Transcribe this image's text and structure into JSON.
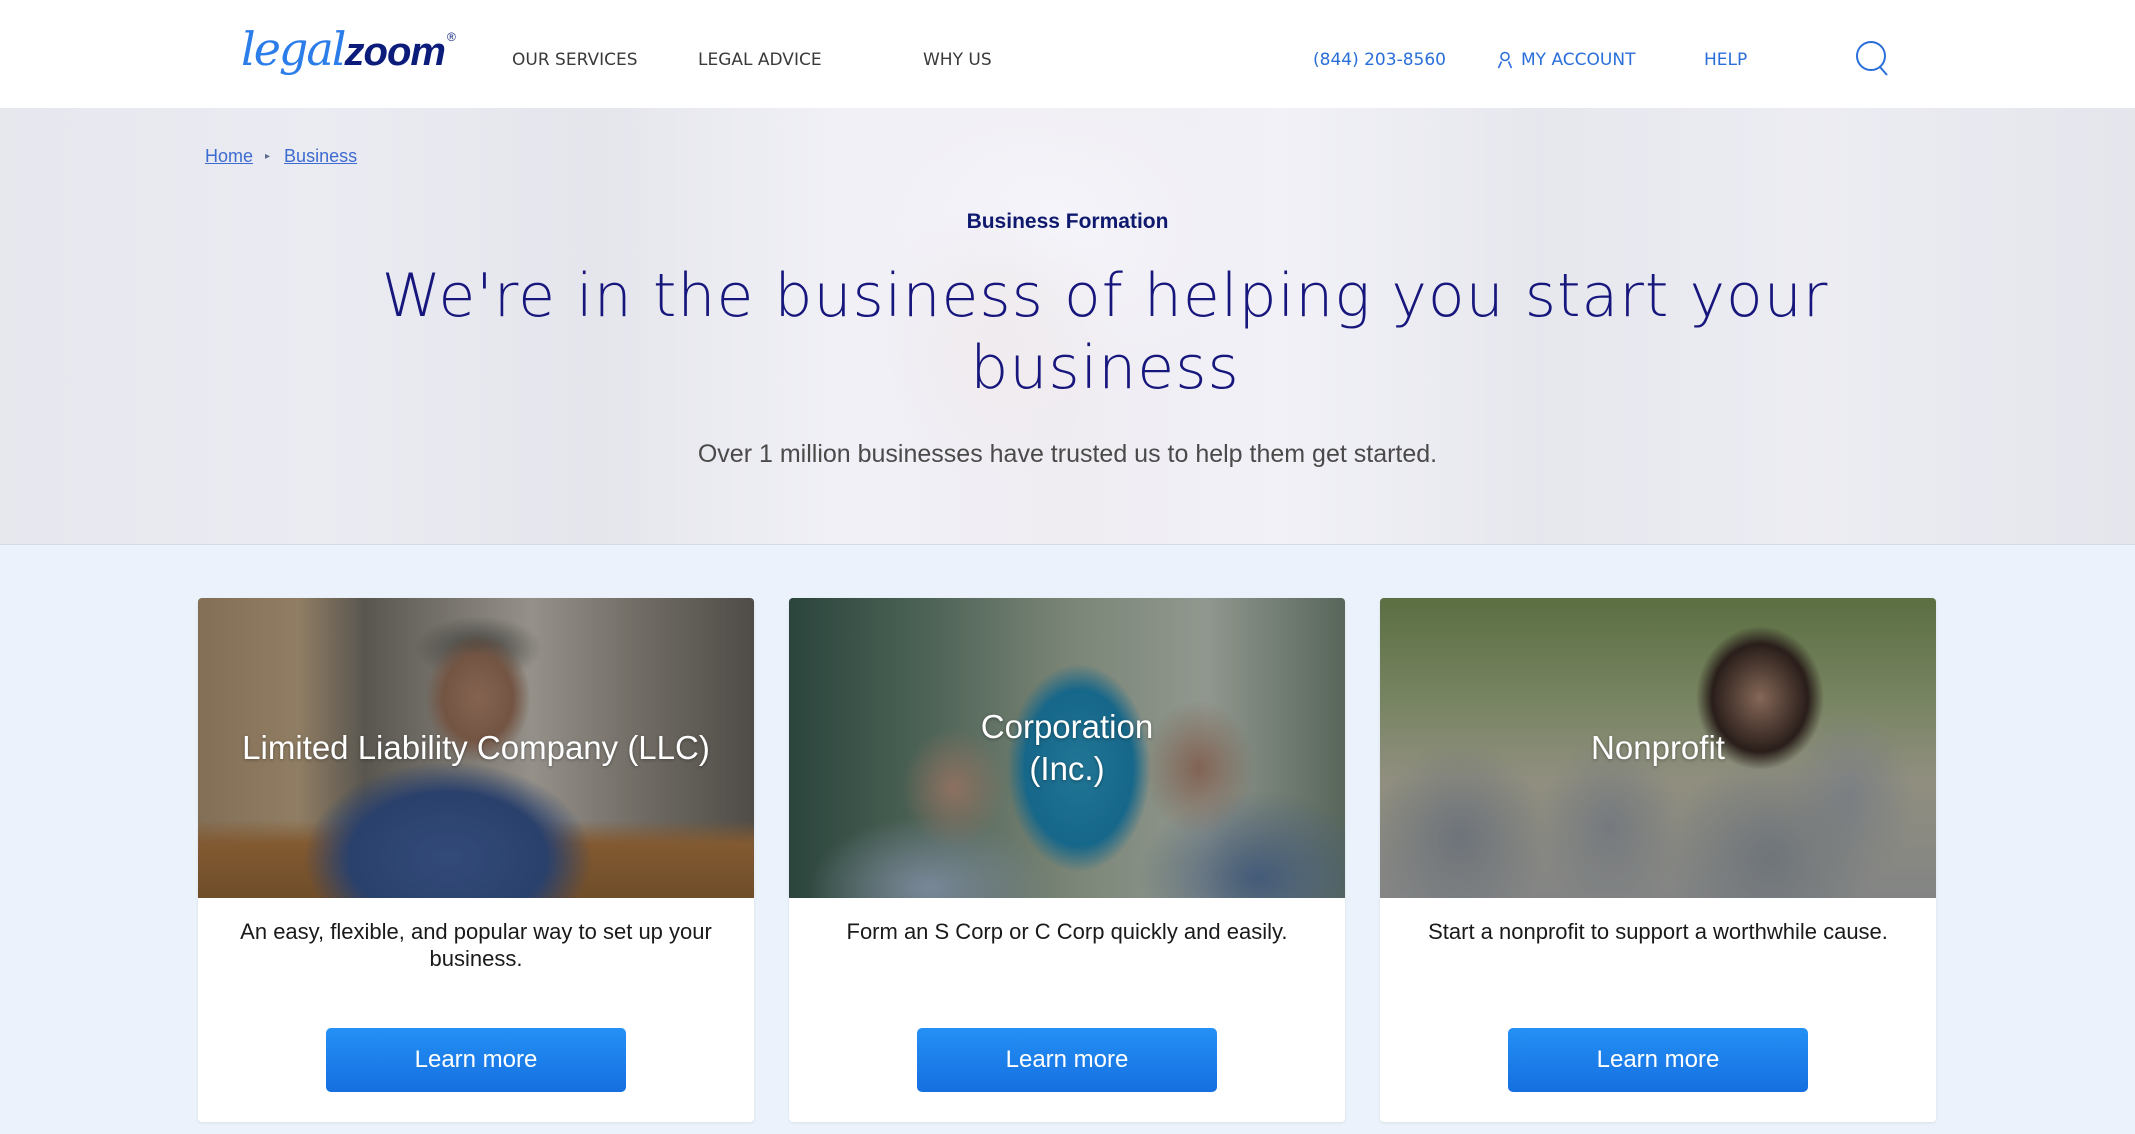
{
  "header": {
    "logo": {
      "part1": "legal",
      "part2": "zoom",
      "registered": "®"
    },
    "nav": [
      {
        "label": "OUR SERVICES"
      },
      {
        "label": "LEGAL ADVICE"
      },
      {
        "label": "WHY US"
      }
    ],
    "phone": "(844) 203-8560",
    "account_label": "MY ACCOUNT",
    "help_label": "HELP",
    "icons": {
      "account": "user-icon",
      "search": "search-icon"
    },
    "accent_color": "#2a6fd9"
  },
  "hero": {
    "breadcrumb": [
      {
        "label": "Home"
      },
      {
        "label": "Business"
      }
    ],
    "breadcrumb_separator": "▸",
    "eyebrow": "Business Formation",
    "title": "We're in the business of helping you start your business",
    "subtitle": "Over 1 million businesses have trusted us to help them get started."
  },
  "cards": [
    {
      "title": "Limited Liability Company (LLC)",
      "description": "An easy, flexible, and popular way to set up your business.",
      "button_label": "Learn more"
    },
    {
      "title": "Corporation (Inc.)",
      "description": "Form an S Corp or C Corp quickly and easily.",
      "button_label": "Learn more"
    },
    {
      "title": "Nonprofit",
      "description": "Start a nonprofit to support a worthwhile cause.",
      "button_label": "Learn more"
    }
  ],
  "colors": {
    "brand_navy": "#16167d",
    "brand_blue": "#2b7de9",
    "button_blue": "#1a7eea",
    "page_background": "#ebf2fb"
  }
}
